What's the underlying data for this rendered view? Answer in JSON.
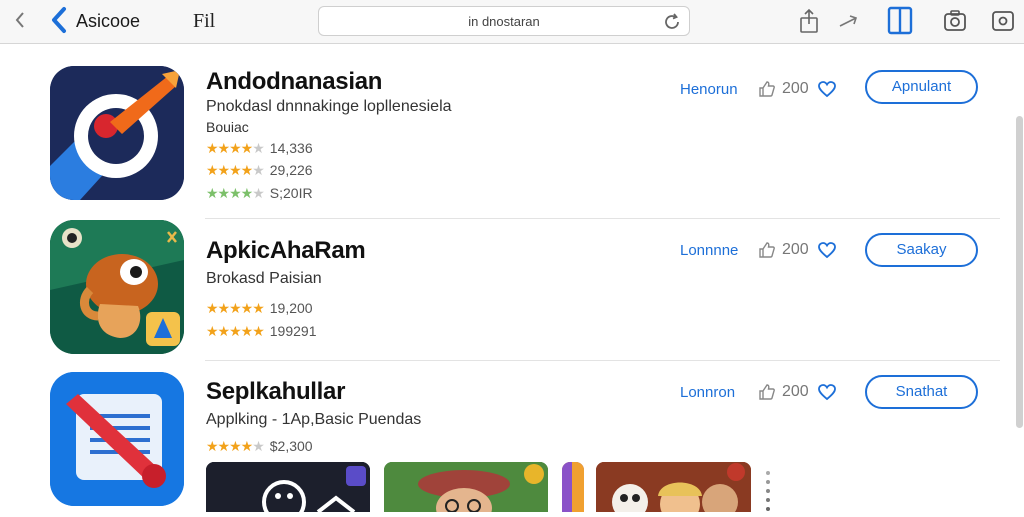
{
  "toolbar": {
    "title": "Asicooe",
    "fil_label": "Fil",
    "url": "in dnostaran",
    "icons": [
      "back-chevron-icon",
      "back-chevron-blue-icon",
      "reload-icon",
      "share-icon",
      "navigate-arrow-icon",
      "phone-icon",
      "camera-icon",
      "photo-icon"
    ]
  },
  "apps": [
    {
      "name": "Andodnanasian",
      "subtitle1": "Pnokdasl dnnnakinge  lopllenesiela",
      "subtitle2": "Bouiac",
      "ratings": [
        {
          "stars": 3.5,
          "count": "14,336"
        },
        {
          "stars": 4,
          "count": "29,226"
        },
        {
          "stars": 4,
          "count": "S;20IR",
          "style": "green"
        }
      ],
      "link": "Henorun",
      "likes": "200",
      "button": "Apnulant"
    },
    {
      "name": "ApkicAhaRam",
      "subtitle1": "Brokasd Paisian",
      "ratings": [
        {
          "stars": 4.5,
          "count": "19,200"
        },
        {
          "stars": 4.5,
          "count": "199291"
        }
      ],
      "link": "Lonnnne",
      "likes": "200",
      "button": "Saakay"
    },
    {
      "name": "Seplkahullar",
      "subtitle1": "Applking - 1Ap,Basic  Puendas",
      "ratings": [
        {
          "stars": 4,
          "count": "$2,300"
        }
      ],
      "link": "Lonnron",
      "likes": "200",
      "button": "Snathat"
    }
  ],
  "colors": {
    "accent": "#1d6fd8",
    "star": "#f2a21b",
    "toolbar_bg": "#f7f7f7"
  }
}
